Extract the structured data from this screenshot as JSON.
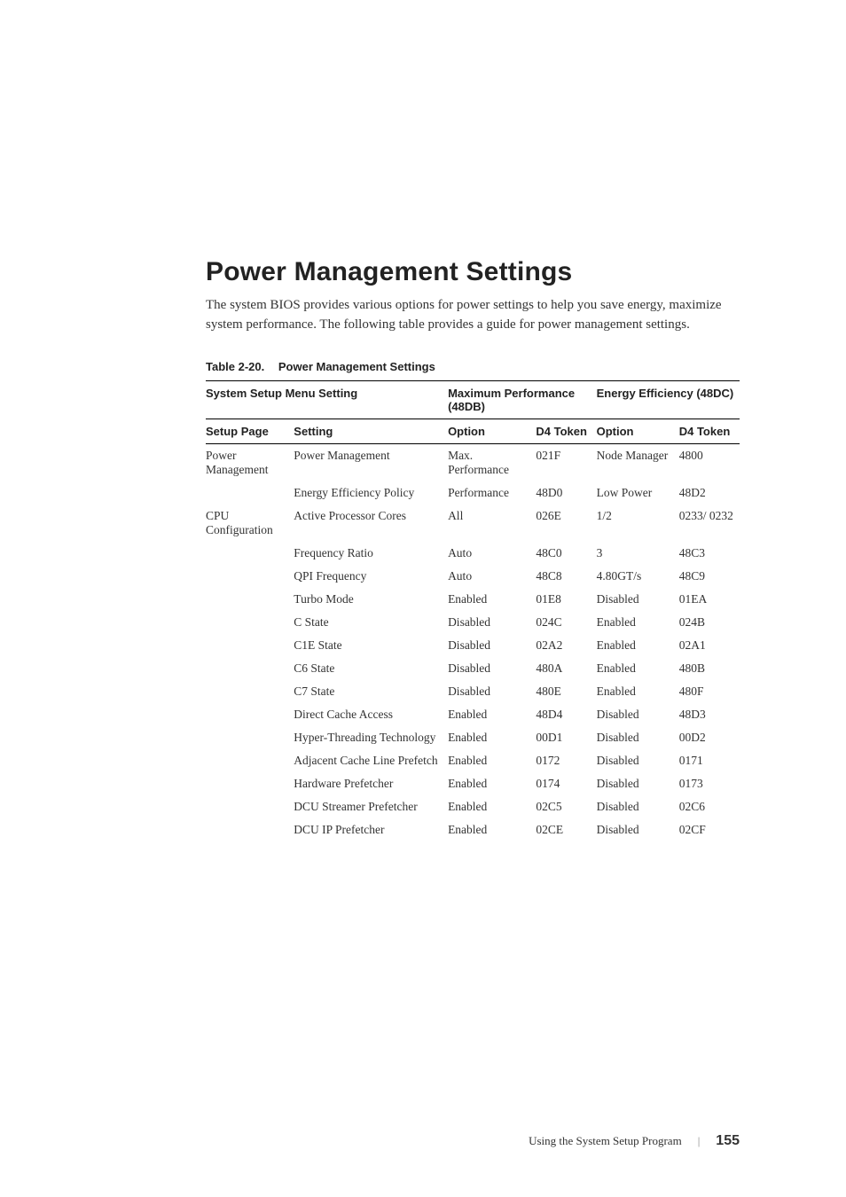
{
  "heading": "Power Management Settings",
  "intro": "The system BIOS provides various options for power settings to help you save energy, maximize system performance. The following table provides a guide for power management settings.",
  "table_caption_number": "Table 2-20.",
  "table_caption_title": "Power Management Settings",
  "headers": {
    "group": "System Setup Menu Setting",
    "maxperf": "Maximum Performance (48DB)",
    "energy": "Energy Efficiency (48DC)",
    "setup_page": "Setup Page",
    "setting": "Setting",
    "option": "Option",
    "d4token": "D4 Token"
  },
  "rows": [
    {
      "page": "Power Management",
      "setting": "Power Management",
      "opt1": "Max. Performance",
      "tok1": "021F",
      "opt2": "Node Manager",
      "tok2": "4800"
    },
    {
      "page": "",
      "setting": "Energy Efficiency Policy",
      "opt1": "Performance",
      "tok1": "48D0",
      "opt2": "Low Power",
      "tok2": "48D2"
    },
    {
      "page": "CPU Configuration",
      "setting": "Active Processor Cores",
      "opt1": "All",
      "tok1": "026E",
      "opt2": "1/2",
      "tok2": "0233/ 0232"
    },
    {
      "page": "",
      "setting": "Frequency Ratio",
      "opt1": "Auto",
      "tok1": "48C0",
      "opt2": "3",
      "tok2": "48C3"
    },
    {
      "page": "",
      "setting": "QPI Frequency",
      "opt1": "Auto",
      "tok1": "48C8",
      "opt2": "4.80GT/s",
      "tok2": "48C9"
    },
    {
      "page": "",
      "setting": "Turbo Mode",
      "opt1": "Enabled",
      "tok1": "01E8",
      "opt2": "Disabled",
      "tok2": "01EA"
    },
    {
      "page": "",
      "setting": "C State",
      "opt1": "Disabled",
      "tok1": "024C",
      "opt2": "Enabled",
      "tok2": "024B"
    },
    {
      "page": "",
      "setting": "C1E State",
      "opt1": "Disabled",
      "tok1": "02A2",
      "opt2": "Enabled",
      "tok2": "02A1"
    },
    {
      "page": "",
      "setting": "C6 State",
      "opt1": "Disabled",
      "tok1": "480A",
      "opt2": "Enabled",
      "tok2": "480B"
    },
    {
      "page": "",
      "setting": "C7 State",
      "opt1": "Disabled",
      "tok1": "480E",
      "opt2": "Enabled",
      "tok2": "480F"
    },
    {
      "page": "",
      "setting": "Direct Cache Access",
      "opt1": "Enabled",
      "tok1": "48D4",
      "opt2": "Disabled",
      "tok2": "48D3"
    },
    {
      "page": "",
      "setting": "Hyper-Threading Technology",
      "opt1": "Enabled",
      "tok1": "00D1",
      "opt2": "Disabled",
      "tok2": "00D2"
    },
    {
      "page": "",
      "setting": "Adjacent Cache Line Prefetch",
      "opt1": "Enabled",
      "tok1": "0172",
      "opt2": "Disabled",
      "tok2": "0171"
    },
    {
      "page": "",
      "setting": "Hardware Prefetcher",
      "opt1": "Enabled",
      "tok1": "0174",
      "opt2": "Disabled",
      "tok2": "0173"
    },
    {
      "page": "",
      "setting": "DCU Streamer Prefetcher",
      "opt1": "Enabled",
      "tok1": "02C5",
      "opt2": "Disabled",
      "tok2": "02C6"
    },
    {
      "page": "",
      "setting": "DCU IP Prefetcher",
      "opt1": "Enabled",
      "tok1": "02CE",
      "opt2": "Disabled",
      "tok2": "02CF"
    }
  ],
  "footer_text": "Using the System Setup Program",
  "page_number": "155"
}
